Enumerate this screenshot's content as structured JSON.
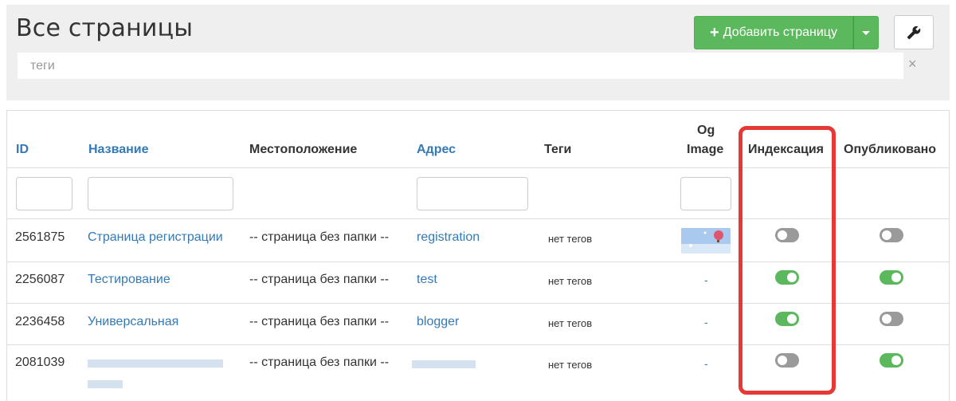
{
  "header": {
    "title": "Все страницы",
    "add_button_label": "Добавить страницу",
    "tags_placeholder": "теги",
    "clear_symbol": "×"
  },
  "table": {
    "columns": {
      "id": "ID",
      "name": "Название",
      "location": "Местоположение",
      "address": "Адрес",
      "tags": "Теги",
      "og_line1": "Og",
      "og_line2": "Image",
      "indexing": "Индексация",
      "published": "Опубликовано"
    },
    "rows": [
      {
        "id": "2561875",
        "name": "Страница регистрации",
        "location": "-- страница без папки --",
        "address": "registration",
        "tags": "нет тегов",
        "og_image": "balloon-thumbnail",
        "indexing": false,
        "published": false
      },
      {
        "id": "2256087",
        "name": "Тестирование",
        "location": "-- страница без папки --",
        "address": "test",
        "tags": "нет тегов",
        "og_image": "-",
        "indexing": true,
        "published": true
      },
      {
        "id": "2236458",
        "name": "Универсальная",
        "location": "-- страница без папки --",
        "address": "blogger",
        "tags": "нет тегов",
        "og_image": "-",
        "indexing": true,
        "published": false
      },
      {
        "id": "2081039",
        "name": "",
        "location": "-- страница без папки --",
        "address": "",
        "tags": "нет тегов",
        "og_image": "-",
        "indexing": false,
        "published": true
      }
    ]
  },
  "colors": {
    "accent_green": "#5cb85c",
    "link_blue": "#337ab7",
    "highlight_red": "#e53935",
    "toggle_off": "#9a9a9a"
  },
  "icons": {
    "plus": "plus-icon",
    "caret": "caret-down-icon",
    "settings": "wrench-icon",
    "clear": "close-icon"
  }
}
